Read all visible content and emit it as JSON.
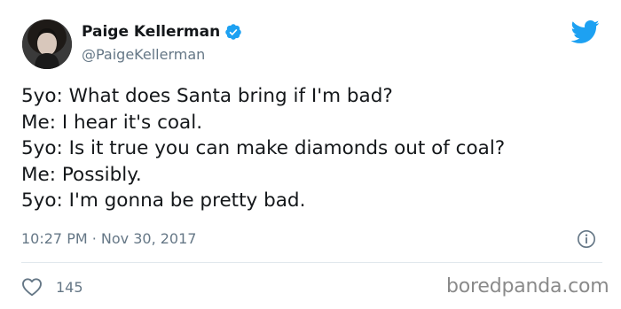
{
  "author": {
    "display_name": "Paige Kellerman",
    "handle": "@PaigeKellerman",
    "verified": true
  },
  "tweet": {
    "lines": [
      "5yo: What does Santa bring if I'm bad?",
      "Me: I hear it's coal.",
      "5yo: Is it true you can make diamonds out of coal?",
      "Me: Possibly.",
      "5yo: I'm gonna be pretty bad."
    ],
    "timestamp": "10:27 PM · Nov 30, 2017"
  },
  "engagement": {
    "likes": "145"
  },
  "watermark": "boredpanda.com",
  "icons": {
    "brand": "twitter-bird-icon",
    "verified": "verified-badge-icon",
    "info": "info-icon",
    "like": "heart-icon"
  },
  "colors": {
    "twitter_blue": "#1da1f2",
    "text_primary": "#14171a",
    "text_secondary": "#657786",
    "divider": "#e1e8ed",
    "watermark": "#8a8a8a"
  }
}
